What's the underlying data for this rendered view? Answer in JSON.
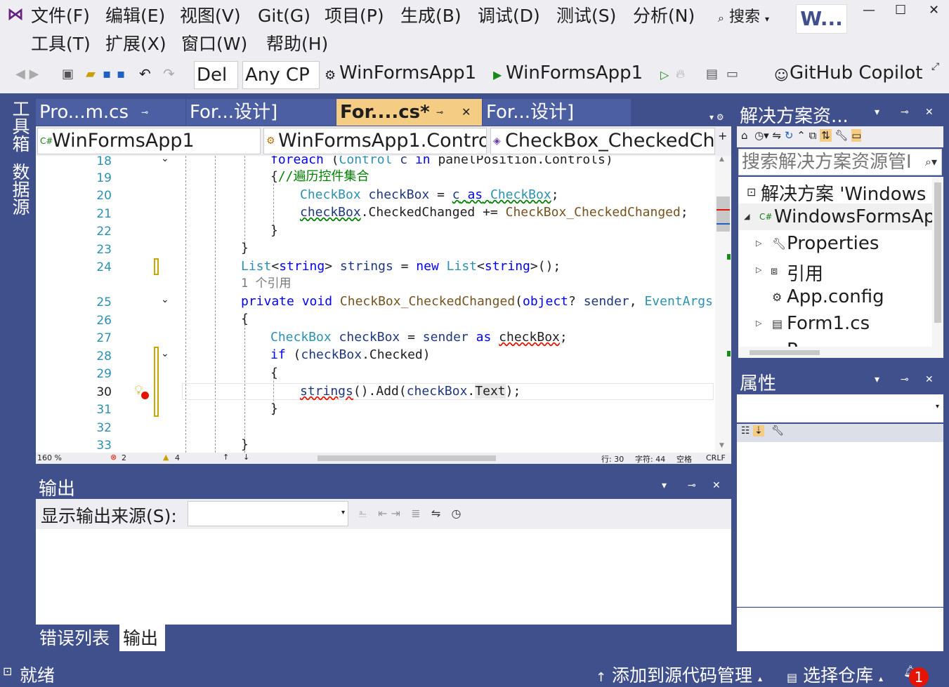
{
  "menu": {
    "row1": [
      "文件(F)",
      "编辑(E)",
      "视图(V)",
      "Git(G)",
      "项目(P)",
      "生成(B)",
      "调试(D)",
      "测试(S)",
      "分析(N)"
    ],
    "row2": [
      "工具(T)",
      "扩展(X)",
      "窗口(W)",
      "帮助(H)"
    ],
    "search": "搜索",
    "window_title": "W..."
  },
  "toolbar": {
    "config": "Del",
    "platform": "Any CP",
    "startup_project": "WinFormsApp1",
    "run_target": "WinFormsApp1",
    "copilot": "GitHub Copilot"
  },
  "side_tabs": [
    "工具箱",
    "数据源"
  ],
  "editor_tabs": [
    {
      "label": "Pro...m.cs",
      "active": false
    },
    {
      "label": "For...设计]",
      "active": false
    },
    {
      "label": "For....cs*",
      "active": true
    },
    {
      "label": "For...设计]",
      "active": false
    }
  ],
  "nav": {
    "project": "WinFormsApp1",
    "class": "WinFormsApp1.Contro",
    "member": "CheckBox_CheckedCh"
  },
  "code": {
    "line_numbers": [
      "18",
      "19",
      "20",
      "21",
      "22",
      "23",
      "24",
      "",
      "25",
      "26",
      "27",
      "28",
      "29",
      "30",
      "31",
      "32",
      "33"
    ],
    "codelens": "1 个引用"
  },
  "editor_status": {
    "zoom": "160 %",
    "errors": "2",
    "warnings": "4",
    "line": "行: 30",
    "char": "字符: 44",
    "space": "空格",
    "eol": "CRLF"
  },
  "output": {
    "title": "输出",
    "source_label": "显示输出来源(S):",
    "source_value": ""
  },
  "bottom_tabs": [
    "错误列表",
    "输出"
  ],
  "solution": {
    "title": "解决方案资...",
    "search_placeholder": "搜索解决方案资源管I",
    "items": [
      "解决方案 'Windows",
      "WindowsFormsAp",
      "Properties",
      "引用",
      "App.config",
      "Form1.cs",
      "P..."
    ]
  },
  "properties": {
    "title": "属性"
  },
  "status": {
    "ready": "就绪",
    "add_source": "添加到源代码管理",
    "select_repo": "选择仓库",
    "notifications": "1"
  }
}
